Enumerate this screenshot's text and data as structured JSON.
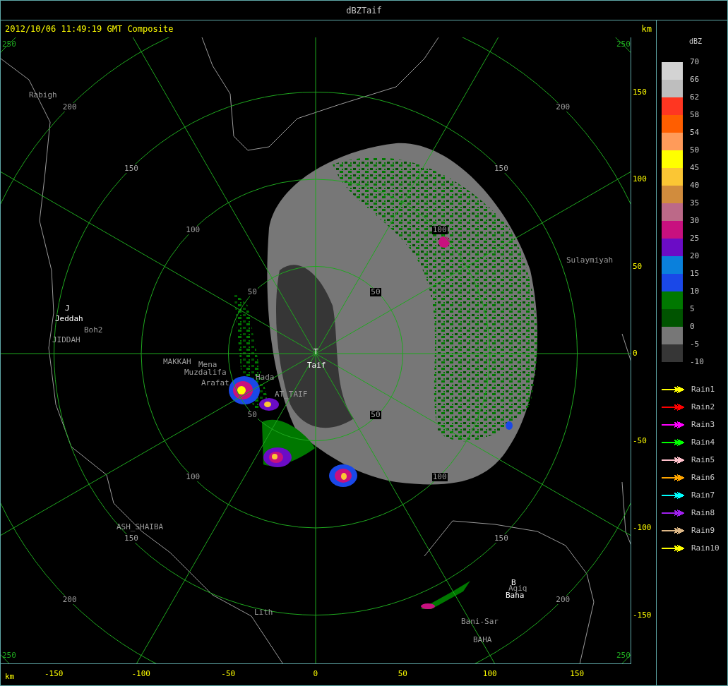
{
  "window": {
    "title": "dBZTaif"
  },
  "header": {
    "timestamp": "2012/10/06 11:49:19 GMT Composite",
    "unit": "km"
  },
  "map": {
    "corner_labels": [
      "250",
      "250",
      "250",
      "250"
    ],
    "ring_labels": [
      "200",
      "150",
      "100",
      "50",
      "200",
      "150",
      "100",
      "50",
      "50",
      "100",
      "150",
      "200",
      "50",
      "100",
      "150",
      "200"
    ],
    "places": [
      {
        "text": "Rabigh",
        "kind": "town"
      },
      {
        "text": "J",
        "kind": "site"
      },
      {
        "text": "Jeddah",
        "kind": "site"
      },
      {
        "text": "Boh2",
        "kind": "town"
      },
      {
        "text": "JIDDAH",
        "kind": "town"
      },
      {
        "text": "MAKKAH",
        "kind": "town"
      },
      {
        "text": "Mena",
        "kind": "town"
      },
      {
        "text": "Muzdalifa",
        "kind": "town"
      },
      {
        "text": "Arafat",
        "kind": "town"
      },
      {
        "text": "Hada",
        "kind": "town"
      },
      {
        "text": "AT_TAIF",
        "kind": "town"
      },
      {
        "text": "T",
        "kind": "site"
      },
      {
        "text": "Taif",
        "kind": "site"
      },
      {
        "text": "Sulaymiyah",
        "kind": "town"
      },
      {
        "text": "ASH_SHAIBA",
        "kind": "town"
      },
      {
        "text": "Lith",
        "kind": "town"
      },
      {
        "text": "Bani-Sar",
        "kind": "town"
      },
      {
        "text": "BAHA",
        "kind": "town"
      },
      {
        "text": "B",
        "kind": "site"
      },
      {
        "text": "Aqiq",
        "kind": "town"
      },
      {
        "text": "Baha",
        "kind": "site"
      }
    ]
  },
  "y_axis": {
    "ticks": [
      "150",
      "100",
      "50",
      "0",
      "-50",
      "-100",
      "-150"
    ]
  },
  "x_axis": {
    "unit": "km",
    "ticks": [
      "-150",
      "-100",
      "-50",
      "0",
      "50",
      "100",
      "150"
    ]
  },
  "legend": {
    "unit": "dBZ",
    "bottom_label": "-10",
    "bins": [
      {
        "label": "70",
        "color": "#d3d3d3"
      },
      {
        "label": "66",
        "color": "#bebebe"
      },
      {
        "label": "62",
        "color": "#ff3621"
      },
      {
        "label": "58",
        "color": "#ff5e00"
      },
      {
        "label": "54",
        "color": "#ff9b5a"
      },
      {
        "label": "50",
        "color": "#ffff00"
      },
      {
        "label": "45",
        "color": "#fbc634"
      },
      {
        "label": "40",
        "color": "#d18c3d"
      },
      {
        "label": "35",
        "color": "#bc6988"
      },
      {
        "label": "30",
        "color": "#c8107f"
      },
      {
        "label": "25",
        "color": "#6b0cc6"
      },
      {
        "label": "20",
        "color": "#0a80dc"
      },
      {
        "label": "15",
        "color": "#1a48e8"
      },
      {
        "label": "10",
        "color": "#007800"
      },
      {
        "label": "5",
        "color": "#005400"
      },
      {
        "label": "0",
        "color": "#777777"
      },
      {
        "label": "-5",
        "color": "#363636"
      }
    ]
  },
  "tracks": [
    {
      "label": "Rain1",
      "color": "#ffff00"
    },
    {
      "label": "Rain2",
      "color": "#ff0000"
    },
    {
      "label": "Rain3",
      "color": "#ff00ff"
    },
    {
      "label": "Rain4",
      "color": "#00ff00"
    },
    {
      "label": "Rain5",
      "color": "#ffc0cb"
    },
    {
      "label": "Rain6",
      "color": "#ffa500"
    },
    {
      "label": "Rain7",
      "color": "#00ffff"
    },
    {
      "label": "Rain8",
      "color": "#a020f0"
    },
    {
      "label": "Rain9",
      "color": "#deb887"
    },
    {
      "label": "Rain10",
      "color": "#ffff00"
    }
  ]
}
